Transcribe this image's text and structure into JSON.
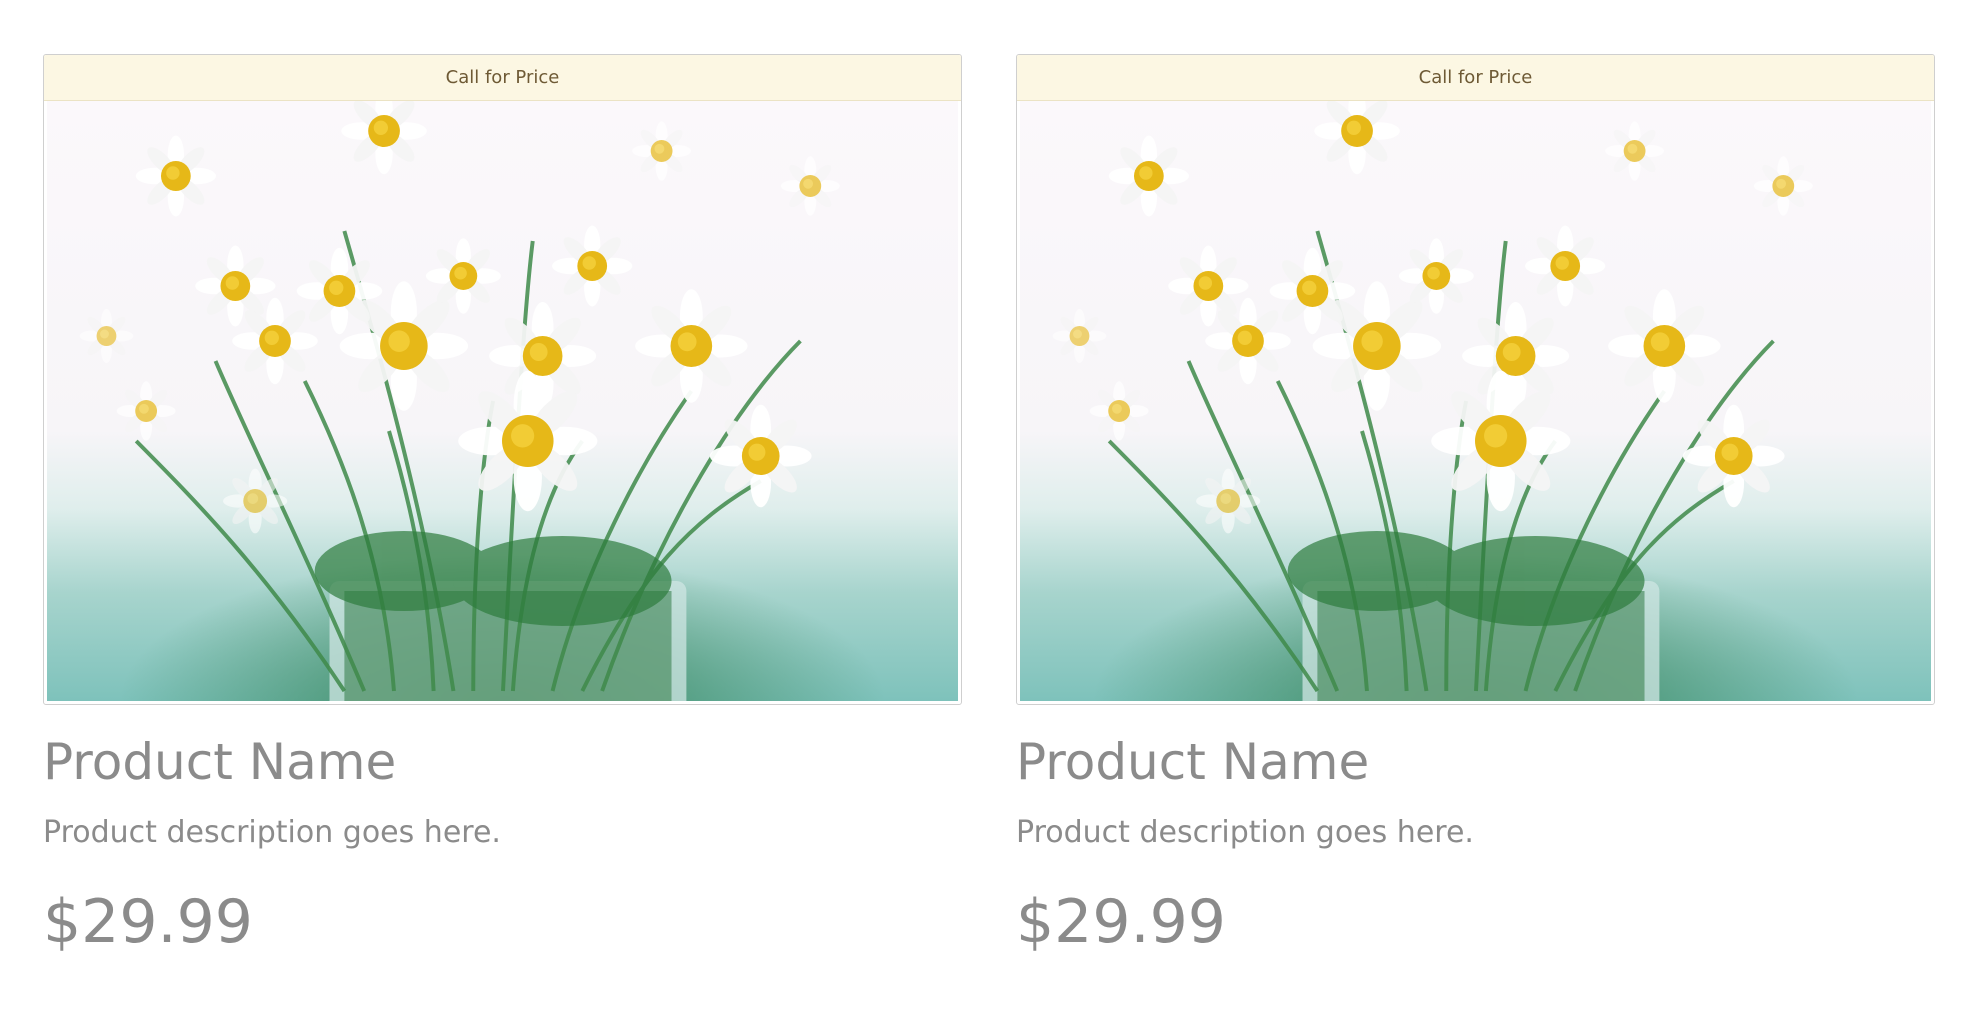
{
  "products": [
    {
      "banner": "Call for Price",
      "image_icon": "daisy-bouquet-photo",
      "name": "Product Name",
      "description": "Product description goes here.",
      "price": "$29.99"
    },
    {
      "banner": "Call for Price",
      "image_icon": "daisy-bouquet-photo",
      "name": "Product Name",
      "description": "Product description goes here.",
      "price": "$29.99"
    }
  ],
  "colors": {
    "banner_bg": "#fcf7e3",
    "banner_text": "#6e5a35",
    "text_gray": "#8b8b8b",
    "petal": "#ffffff",
    "flower_center": "#e6b818",
    "stem": "#3f8a4a",
    "backdrop_teal": "#7ec2bb"
  }
}
